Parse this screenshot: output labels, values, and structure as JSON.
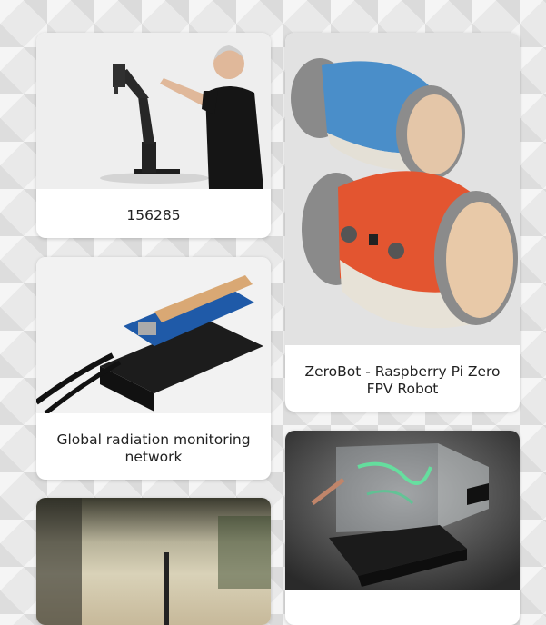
{
  "cards": [
    {
      "caption": "156285",
      "image": "robotic-arm-photo"
    },
    {
      "caption": "ZeroBot - Raspberry Pi Zero FPV Robot",
      "image": "zerobot-photo"
    },
    {
      "caption": "Global radiation monitoring network",
      "image": "radiation-sensor-photo"
    },
    {
      "caption": "",
      "image": "blurred-photo"
    },
    {
      "caption": "",
      "image": "holographic-display-photo"
    }
  ]
}
